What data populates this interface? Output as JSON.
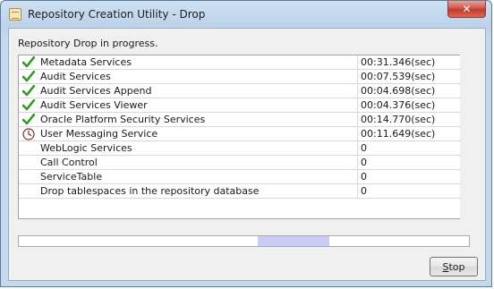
{
  "window": {
    "title": "Repository Creation Utility - Drop",
    "close_label": "✕"
  },
  "status": {
    "text": "Repository Drop in progress."
  },
  "table": {
    "rows": [
      {
        "name": "Metadata Services",
        "time": "00:31.346(sec)",
        "icon": "check-icon"
      },
      {
        "name": "Audit Services",
        "time": "00:07.539(sec)",
        "icon": "check-icon"
      },
      {
        "name": "Audit Services Append",
        "time": "00:04.698(sec)",
        "icon": "check-icon"
      },
      {
        "name": "Audit Services Viewer",
        "time": "00:04.376(sec)",
        "icon": "check-icon"
      },
      {
        "name": "Oracle Platform Security Services",
        "time": "00:14.770(sec)",
        "icon": "check-icon"
      },
      {
        "name": "User Messaging Service",
        "time": "00:11.649(sec)",
        "icon": "clock-icon"
      },
      {
        "name": "WebLogic Services",
        "time": "0",
        "icon": ""
      },
      {
        "name": "Call Control",
        "time": "0",
        "icon": ""
      },
      {
        "name": "ServiceTable",
        "time": "0",
        "icon": ""
      },
      {
        "name": "Drop tablespaces in the repository database",
        "time": "0",
        "icon": ""
      }
    ]
  },
  "progress": {
    "style": "indeterminate",
    "segment_start": 0.53,
    "segment_end": 0.69,
    "fill_color": "#c9ccf7"
  },
  "buttons": {
    "stop_mnemonic": "S",
    "stop_rest": "top"
  },
  "colors": {
    "check": "#2e9a1f",
    "titlebar": "#bcd3ea",
    "close": "#c43a2c"
  }
}
